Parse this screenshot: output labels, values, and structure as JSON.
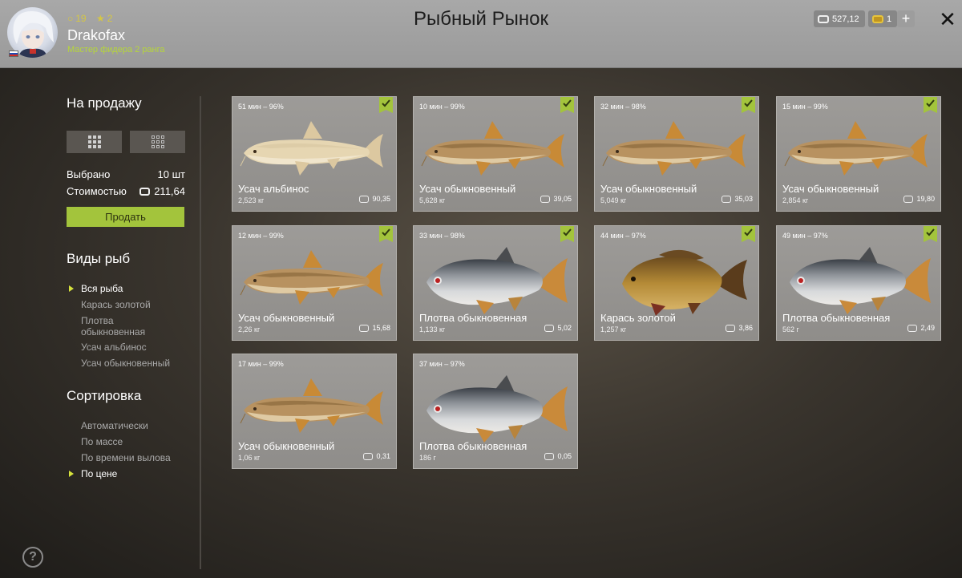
{
  "header": {
    "title": "Рыбный Рынок",
    "username": "Drakofax",
    "rank": "Мастер фидера 2 ранга",
    "level": "19",
    "stars": "2",
    "silver": "527,12",
    "gold": "1",
    "plus": "+",
    "close": "✕"
  },
  "sidebar": {
    "for_sale_title": "На продажу",
    "selected_label": "Выбрано",
    "selected_value": "10 шт",
    "cost_label": "Стоимостью",
    "cost_value": "211,64",
    "sell_button": "Продать",
    "species_title": "Виды рыб",
    "species": [
      {
        "label": "Вся рыба",
        "active": true
      },
      {
        "label": "Карась золотой",
        "active": false
      },
      {
        "label": "Плотва\nобыкновенная",
        "active": false
      },
      {
        "label": "Усач альбинос",
        "active": false
      },
      {
        "label": "Усач обыкновенный",
        "active": false
      }
    ],
    "sort_title": "Сортировка",
    "sort": [
      {
        "label": "Автоматически",
        "active": false
      },
      {
        "label": "По массе",
        "active": false
      },
      {
        "label": "По времени вылова",
        "active": false
      },
      {
        "label": "По цене",
        "active": true
      }
    ],
    "help": "?"
  },
  "fish": [
    {
      "time": "51 мин – 96%",
      "name": "Усач альбинос",
      "weight": "2,523 кг",
      "price": "90,35",
      "kind": "barbel-albino",
      "checked": true
    },
    {
      "time": "10 мин – 99%",
      "name": "Усач обыкновенный",
      "weight": "5,628 кг",
      "price": "39,05",
      "kind": "barbel",
      "checked": true
    },
    {
      "time": "32 мин – 98%",
      "name": "Усач обыкновенный",
      "weight": "5,049 кг",
      "price": "35,03",
      "kind": "barbel",
      "checked": true
    },
    {
      "time": "15 мин – 99%",
      "name": "Усач обыкновенный",
      "weight": "2,854 кг",
      "price": "19,80",
      "kind": "barbel",
      "checked": true
    },
    {
      "time": "12 мин – 99%",
      "name": "Усач обыкновенный",
      "weight": "2,26 кг",
      "price": "15,68",
      "kind": "barbel",
      "checked": true
    },
    {
      "time": "33 мин – 98%",
      "name": "Плотва обыкновенная",
      "weight": "1,133 кг",
      "price": "5,02",
      "kind": "roach",
      "checked": true
    },
    {
      "time": "44 мин – 97%",
      "name": "Карась золотой",
      "weight": "1,257 кг",
      "price": "3,86",
      "kind": "carp",
      "checked": true
    },
    {
      "time": "49 мин – 97%",
      "name": "Плотва обыкновенная",
      "weight": "562 г",
      "price": "2,49",
      "kind": "roach",
      "checked": true
    },
    {
      "time": "17 мин – 99%",
      "name": "Усач обыкновенный",
      "weight": "1,06 кг",
      "price": "0,31",
      "kind": "barbel",
      "checked": false
    },
    {
      "time": "37 мин – 97%",
      "name": "Плотва обыкновенная",
      "weight": "186 г",
      "price": "0,05",
      "kind": "roach",
      "checked": false
    }
  ],
  "colors": {
    "accent": "#a3c43c",
    "header_bg": "#a3a3a3",
    "card_bg": "#9a9895",
    "rank_text": "#b6d63a"
  }
}
